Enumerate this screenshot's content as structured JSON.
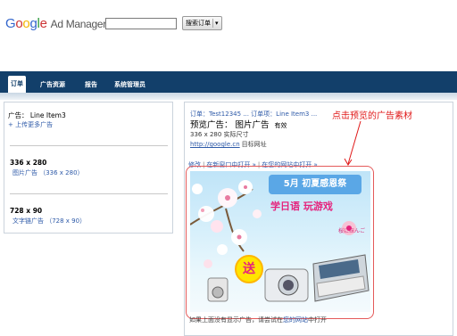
{
  "header": {
    "logo": {
      "g": "G",
      "o1": "o",
      "o2": "o",
      "g2": "g",
      "l": "l",
      "e": "e",
      "product": "Ad Manager"
    },
    "search_button": "搜索订单",
    "search_placeholder": ""
  },
  "nav": {
    "tabs": [
      "订单",
      "广告资源",
      "报告",
      "系统管理员"
    ],
    "active_index": 0
  },
  "left": {
    "item_title": "广告：  Line Item3",
    "upload_link": "+ 上传更多广告",
    "creatives": [
      {
        "size": "336 x 280",
        "link": "图片广告 （336 x 280）"
      },
      {
        "size": "728 x 90",
        "link": "文字链广告 （728 x 90）"
      }
    ]
  },
  "right": {
    "breadcrumb": "订单：Test12345 ... 订单项：Line Item3 ...",
    "preview_title": "预览广告：  图片广告",
    "status": "有效",
    "actual_size": "336 x 280 实际尺寸",
    "target_url": "http://google.cn",
    "target_url_label": "目标网址",
    "annotation": "点击预览的广告素材",
    "actions": [
      "修改",
      "在新窗口中打开 »",
      "在您的网站中打开 »"
    ],
    "bottom_note_prefix": "如果上面没有显示广告，请尝试在",
    "bottom_note_link": "您的网站",
    "bottom_note_suffix": "中打开"
  },
  "ad": {
    "month": "5月 初夏感恩祭",
    "slogan": "学日语  玩游戏",
    "brand": "桜にほんご",
    "send": "送"
  },
  "colors": {
    "nav": "#123f6a",
    "link": "#2e5aa8",
    "annotation": "#e01818",
    "ad_sky": "#bfe4f8",
    "ad_pink": "#e5237d"
  }
}
